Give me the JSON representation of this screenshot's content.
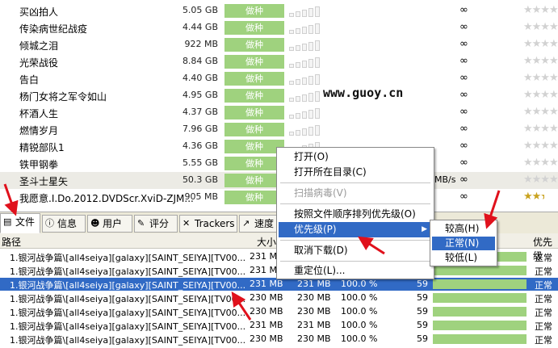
{
  "torrents": [
    {
      "name": "买凶拍人",
      "size": "5.05 GB",
      "status": "做种",
      "availability": "∞",
      "stars": "★★★★"
    },
    {
      "name": "传染病世纪战疫",
      "size": "4.44 GB",
      "status": "做种",
      "availability": "∞",
      "stars": "★★★★"
    },
    {
      "name": "倾城之泪",
      "size": "922 MB",
      "status": "做种",
      "availability": "∞",
      "stars": "★★★★"
    },
    {
      "name": "光荣战役",
      "size": "8.84 GB",
      "status": "做种",
      "availability": "∞",
      "stars": "★★★★"
    },
    {
      "name": "告白",
      "size": "4.40 GB",
      "status": "做种",
      "availability": "∞",
      "stars": "★★★★"
    },
    {
      "name": "杨门女将之军令如山",
      "size": "4.95 GB",
      "status": "做种",
      "availability": "∞",
      "stars": "★★★★"
    },
    {
      "name": "杯酒人生",
      "size": "4.37 GB",
      "status": "做种",
      "availability": "∞",
      "stars": "★★★★"
    },
    {
      "name": "燃情岁月",
      "size": "7.96 GB",
      "status": "做种",
      "availability": "∞",
      "stars": "★★★★"
    },
    {
      "name": "精锐部队1",
      "size": "4.36 GB",
      "status": "做种",
      "availability": "∞",
      "stars": "★★★★"
    },
    {
      "name": "铁甲钢拳",
      "size": "5.55 GB",
      "status": "做种",
      "availability": "∞",
      "stars": "★★★★"
    },
    {
      "name": "圣斗士星矢",
      "size": "50.3 GB",
      "status": "做种",
      "availability": "∞",
      "stars": "★★★★",
      "speed_fragment": "MB/s"
    },
    {
      "name": "我愿意.I.Do.2012.DVDScr.XviD-ZJM...",
      "size": "905 MB",
      "status": "做种",
      "availability": "∞",
      "stars": "★★★★"
    }
  ],
  "watermark": "www.guoy.cn",
  "tabs": [
    {
      "label": "文件",
      "icon": "file-icon"
    },
    {
      "label": "信息",
      "icon": "info-icon"
    },
    {
      "label": "用户",
      "icon": "users-icon"
    },
    {
      "label": "评分",
      "icon": "rating-icon"
    },
    {
      "label": "Trackers",
      "icon": "trackers-icon"
    },
    {
      "label": "速度",
      "icon": "speed-icon"
    }
  ],
  "file_columns": {
    "path": "路径",
    "size": "大小",
    "priority": "优先级"
  },
  "files": [
    {
      "path": "1.银河战争篇\\[all4seiya][galaxy][SAINT_SEIYA][TV00...",
      "size": "231 MB",
      "priority": "正常"
    },
    {
      "path": "1.银河战争篇\\[all4seiya][galaxy][SAINT_SEIYA][TV00...",
      "size": "231 MB",
      "priority": "正常"
    },
    {
      "path": "1.银河战争篇\\[all4seiya][galaxy][SAINT_SEIYA][TV00...",
      "size": "231 MB",
      "done": "231 MB",
      "percent": "100.0 %",
      "pieces": "59",
      "priority": "正常"
    },
    {
      "path": "1.银河战争篇\\[all4seiya][galaxy][SAINT_SEIYA][TV00...",
      "size": "230 MB",
      "done": "230 MB",
      "percent": "100.0 %",
      "pieces": "59",
      "priority": "正常"
    },
    {
      "path": "1.银河战争篇\\[all4seiya][galaxy][SAINT_SEIYA][TV00...",
      "size": "230 MB",
      "done": "230 MB",
      "percent": "100.0 %",
      "pieces": "59",
      "priority": "正常"
    },
    {
      "path": "1.银河战争篇\\[all4seiya][galaxy][SAINT_SEIYA][TV00...",
      "size": "231 MB",
      "done": "231 MB",
      "percent": "100.0 %",
      "pieces": "59",
      "priority": "正常"
    },
    {
      "path": "1.银河战争篇\\[all4seiya][galaxy][SAINT_SEIYA][TV00...",
      "size": "230 MB",
      "done": "230 MB",
      "percent": "100.0 %",
      "pieces": "59",
      "priority": "正常"
    }
  ],
  "context_menu": {
    "open": "打开(O)",
    "open_folder": "打开所在目录(C)",
    "scan_virus": "扫描病毒(V)",
    "sort_priority": "按照文件顺序排列优先级(O)",
    "priority": "优先级(P)",
    "cancel_download": "取消下载(D)",
    "relocate": "重定位(L)..."
  },
  "priority_submenu": {
    "high": "较高(H)",
    "normal": "正常(N)",
    "low": "较低(L)"
  },
  "colors": {
    "status_green": "#9fd27e",
    "selection": "#316ac5",
    "arrow_red": "#e0111c",
    "star_gold": "#c9a21e"
  }
}
